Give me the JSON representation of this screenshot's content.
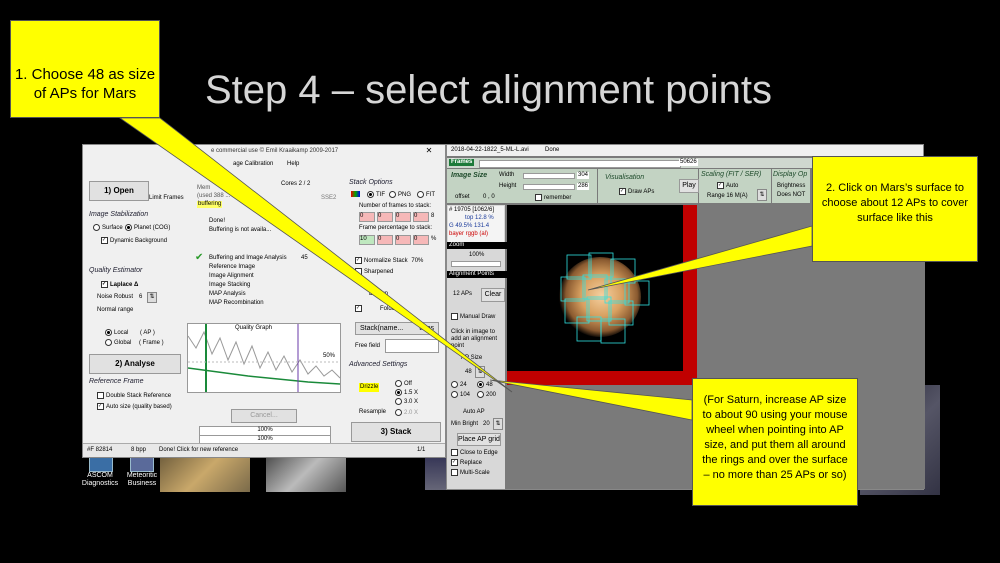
{
  "slide": {
    "title": "Step 4 – select alignment points"
  },
  "callouts": {
    "c1": "1. Choose 48 as size of APs for Mars",
    "c2": "2. Click on Mars’s surface to choose about 12 APs to cover surface like this",
    "c3": "(For Saturn, increase AP size to about 90 using your mouse wheel when pointing into AP size, and put them all around the rings and over the surface – no more than 25 APs or so)"
  },
  "as_window": {
    "title_fragment": "e commercial use © Emil Kraaikamp 2009-2017",
    "menu": [
      "age Calibration",
      "Help"
    ],
    "left": {
      "open_btn": "1) Open",
      "limit_frames": "Limit Frames",
      "image_stab": "Image Stabilization",
      "surface": "Surface",
      "planet": "Planet (COG)",
      "dynamic_bg": "Dynamic Background",
      "quality_est": "Quality Estimator",
      "laplace": "Laplace Δ",
      "noise_robust": "Noise Robust",
      "noise_val": "6",
      "normal_range": "Normal range",
      "local": "Local",
      "local_ap": "( AP )",
      "global": "Global",
      "global_frame": "( Frame )",
      "analyse_btn": "2) Analyse",
      "ref_frame": "Reference Frame",
      "double_stack": "Double Stack Reference",
      "auto_size": "Auto size (quality based)"
    },
    "middle": {
      "cores": "Cores 2 / 2",
      "sse": "SSE2",
      "mem1": "Mem",
      "mem2": "(used 388 ...",
      "buffering_tag": "buffering",
      "done": "Done!",
      "buffering_na": "Buffering is not availa...",
      "steps": [
        "Buffering and Image Analysis",
        "Reference Image",
        "Image Alignment",
        "Image Stacking",
        "MAP Analysis",
        "MAP Recombination"
      ],
      "step_pct": "45",
      "quality_graph": "Quality Graph",
      "pct50": "50%",
      "cancel": "Cancel...",
      "prog1": "100%",
      "prog2": "100%"
    },
    "right": {
      "stack_options": "Stack Options",
      "tif": "TIF",
      "png": "PNG",
      "fit": "FIT",
      "num_frames": "Number of frames to stack:",
      "nf": [
        "0",
        "0",
        "0",
        "0"
      ],
      "nf_unit": "8",
      "frame_pct": "Frame percentage to stack:",
      "fp": [
        "10",
        "0",
        "0",
        "0"
      ],
      "fp_unit": "%",
      "normalize": "Normalize Stack",
      "normalize_val": "70%",
      "sharpened": "Sharpened",
      "align": "D Align",
      "folders": "Folders",
      "stack_btn": "Stack(name...",
      "stack_btn2": "tions",
      "free_field": "Free field",
      "adv": "Advanced Settings",
      "drizzle": "Drizzle",
      "off": "Off",
      "x15": "1.5 X",
      "x30": "3.0 X",
      "resample": "Resample",
      "x20": "2.0 X",
      "stack3": "3) Stack"
    },
    "status": {
      "frame": "#F 82814",
      "bpp": "8 bpp",
      "msg": "Done! Click for new reference",
      "page": "1/1"
    }
  },
  "ap_window": {
    "title": "2018-04-22-1822_5-ML-L.avi",
    "title_status": "Done",
    "frames_label": "Frames",
    "frames_val": "50626",
    "image_size": "Image Size",
    "width_label": "Width",
    "width_val": "304",
    "height_label": "Height",
    "height_val": "286",
    "offset_label": "offset",
    "offset_val": "0 , 0",
    "remember": "remember",
    "visualisation": "Visualisation",
    "draw_aps": "Draw APs",
    "play": "Play",
    "scaling": "Scaling (FIT / SER)",
    "auto": "Auto",
    "range": "Range 16 M(A)",
    "display_op": "Display Op",
    "brightness": "Brightness",
    "does_not": "Does NOT",
    "info1": "# 19705 [1062/6]",
    "info2": "top 12.8 %",
    "info3": "G 49.5% 131.4",
    "info4": "bayer rggb (al)",
    "zoom": "Zoom",
    "zoom_val": "100%",
    "alignment_points": "Alignment Points",
    "aps_count": "12 APs",
    "clear": "Clear",
    "manual_draw": "Manual Draw",
    "click_hint": "Click in image to add an alignment point",
    "ap_size": "AP Size",
    "ap_size_val": "48",
    "s24": "24",
    "s48": "48",
    "s104": "104",
    "s200": "200",
    "auto_ap": "Auto AP",
    "min_bright": "Min Bright",
    "min_bright_val": "20",
    "place_grid": "Place AP grid",
    "close_edge": "Close to Edge",
    "replace": "Replace",
    "multi_scale": "Multi-Scale"
  },
  "desktop": {
    "icon1": "ASCOM Diagnostics",
    "icon2": "Meteoritic Business"
  }
}
